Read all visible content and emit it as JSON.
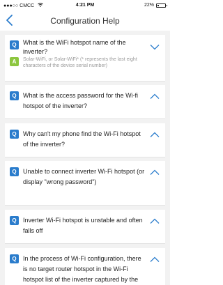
{
  "status_bar": {
    "carrier": "CMCC",
    "time": "4:21 PM",
    "battery": "22%"
  },
  "nav": {
    "title": "Configuration Help"
  },
  "faq": [
    {
      "question": "What is the WiFi hotspot name of the inverter?",
      "answer": "Solar-WiFi, or Solar-WiFi* (* represents the last eight characters of the device serial number)",
      "expanded": true
    },
    {
      "question": "What is the access password for the Wi-fi hotspot of the inverter?",
      "expanded": false
    },
    {
      "question": "Why can't my phone find the Wi-Fi hotspot of the inverter?",
      "expanded": false
    },
    {
      "question": "Unable to connect inverter Wi-Fi hotspot (or display \"wrong password\")",
      "expanded": false
    },
    {
      "question": "Inverter Wi-Fi hotspot is unstable and often falls off",
      "expanded": false
    },
    {
      "question": "In the process of Wi-Fi configuration, there is no target router hotspot in the Wi-Fi hotspot list of the inverter captured by the",
      "expanded": false
    }
  ],
  "colors": {
    "accent": "#2a7ccc",
    "answer_badge": "#8cc63f"
  },
  "icons": {
    "back": "chevron-left-icon",
    "expanded": "chevron-down-icon",
    "collapsed": "chevron-up-icon"
  }
}
